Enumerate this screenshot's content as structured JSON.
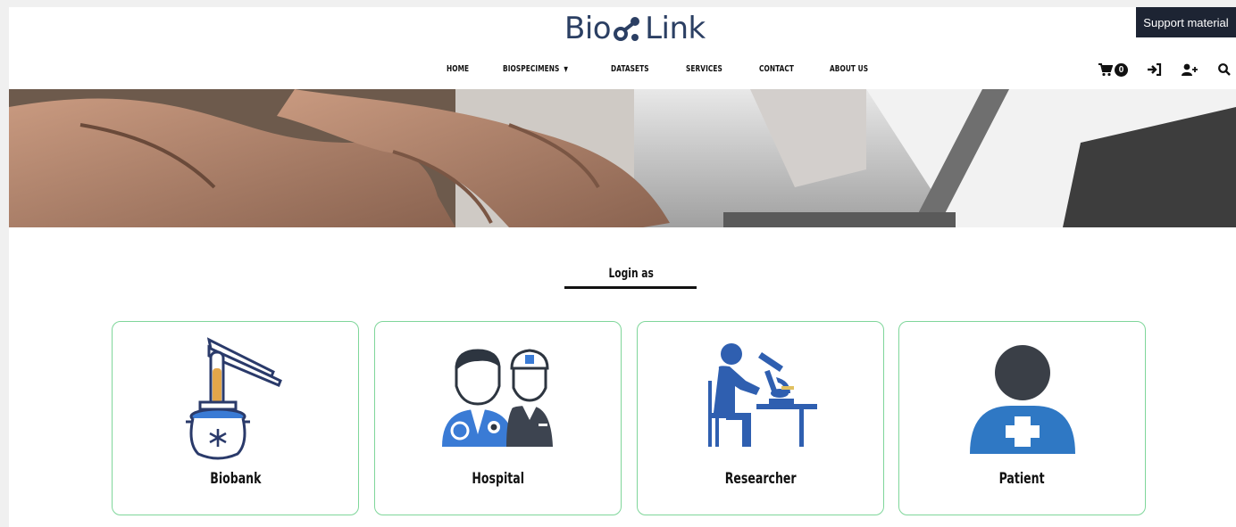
{
  "header": {
    "logo_text_1": "Bio",
    "logo_text_2": "Link",
    "support_label": "Support material"
  },
  "nav": {
    "items": [
      "HOME",
      "BIOSPECIMENS",
      "DATASETS",
      "SERVICES",
      "CONTACT",
      "ABOUT US"
    ]
  },
  "toolbar": {
    "cart_count": "0",
    "icons": [
      "cart-icon",
      "sign-in-icon",
      "user-plus-icon",
      "search-icon"
    ]
  },
  "login": {
    "title": "Login as",
    "options": [
      {
        "label": "Biobank",
        "icon": "biobank-icon"
      },
      {
        "label": "Hospital",
        "icon": "hospital-icon"
      },
      {
        "label": "Researcher",
        "icon": "researcher-icon"
      },
      {
        "label": "Patient",
        "icon": "patient-icon"
      }
    ]
  },
  "colors": {
    "brand": "#2b3f63",
    "card_border": "#7fd69a",
    "icon_blue": "#2f6db5",
    "dark": "#1d2433"
  }
}
